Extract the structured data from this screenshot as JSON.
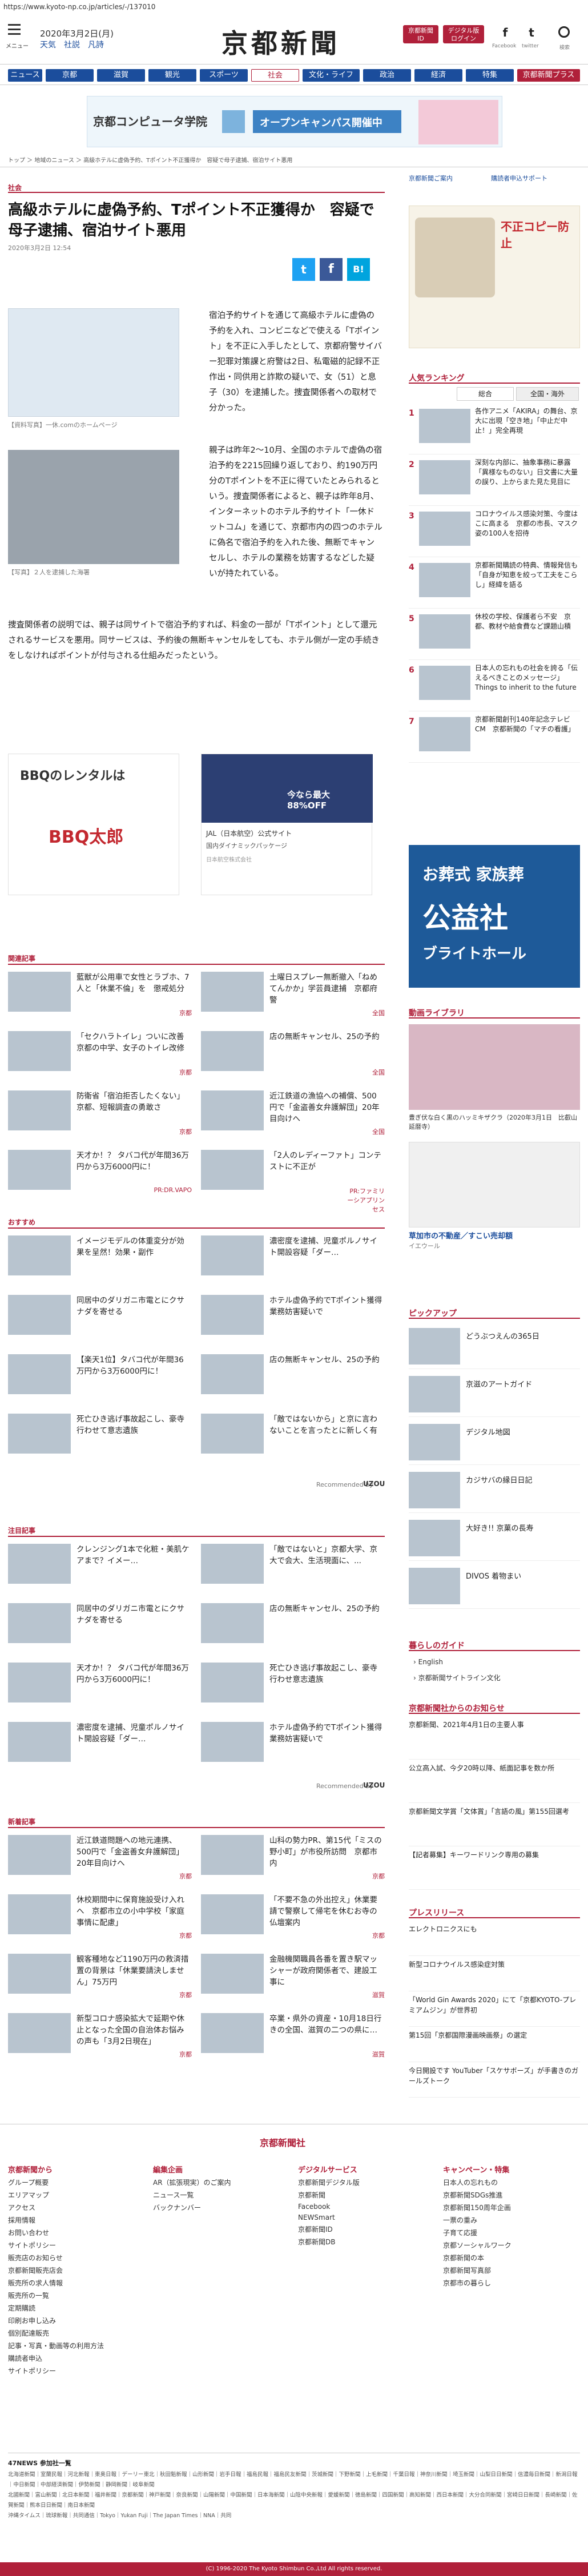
{
  "browser": {
    "url": "https://www.kyoto-np.co.jp/articles/-/137010"
  },
  "header": {
    "menu_label": "メニュー",
    "date": "2020年3月2日(月)",
    "weather": "天気　社説　凡詩",
    "logo": "京都新聞",
    "btn_top_label": "京都新聞\nID",
    "btn_digital_label": "デジタル版\nログイン",
    "facebook_label": "Facebook",
    "twitter_label": "twitter",
    "search_label": "検索"
  },
  "nav": {
    "items": [
      "ニュース",
      "京都",
      "滋賀",
      "観光",
      "スポーツ",
      "社会",
      "文化・ライフ",
      "政治",
      "経済",
      "特集",
      "京都新聞プラス"
    ],
    "colors": [
      "#1b4d9c",
      "#1b4d9c",
      "#1b4d9c",
      "#1b4d9c",
      "#b0203a",
      "#fff",
      "#1b4d9c",
      "#1b4d9c",
      "#1b4d9c",
      "#1b4d9c",
      "#b0203a"
    ]
  },
  "banner": {
    "school": "京都コンピュータ学院",
    "campaign": "オープンキャンパス開催中"
  },
  "breadcrumb": "トップ ＞ 地域のニュース ＞ 高級ホテルに虚偽予約、Tポイント不正獲得か　容疑で母子逮捕、宿泊サイト悪用",
  "article": {
    "section": "社会",
    "title": "高級ホテルに虚偽予約、Tポイント不正獲得か　容疑で母子逮捕、宿泊サイト悪用",
    "date": "2020年3月2日 12:54",
    "photo1_caption": "【資料写真】一休.comのホームページ",
    "photo2_caption": "【写真】２人を逮捕した海署",
    "para1": "宿泊予約サイトを通じて高級ホテルに虚偽の予約を入れ、コンビニなどで使える「Tポイント」を不正に入手したとして、京都府警サイバー犯罪対策課と府警は2日、私電磁的記録不正作出・同供用と詐欺の疑いで、女（51）と息子（30）を逮捕した。捜査関係者への取材で分かった。",
    "para2": "親子は昨年2～10月、全国のホテルで虚偽の宿泊予約を2215回繰り返しており、約190万円分のTポイントを不正に得ていたとみられるという。捜査関係者によると、親子は昨年8月、インターネットのホテル予約サイト「一休ドットコム」を通じて、京都市内の四つのホテルに偽名で宿泊予約を入れた後、無断でキャンセルし、ホテルの業務を妨害するなどした疑いが持たれている。",
    "para3": "捜査関係者の説明では、親子は同サイトで宿泊予約すれば、料金の一部が「Tポイント」として還元されるサービスを悪用。同サービスは、予約後の無断キャンセルをしても、ホテル側が一定の手続きをしなければポイントが付与される仕組みだったという。",
    "share_fb": "f",
    "share_tw": "t",
    "share_hb": "B!"
  },
  "ad_mid": {
    "bbq_title": "BBQのレンタルは",
    "bbq_brand": "BBQ太郎",
    "jal_sale": "今なら最大88%OFF",
    "jal_name": "JAL（日本航空）公式サイト",
    "jal_text": "国内ダイナミックパッケージ",
    "jal_note": "日本航空株式会社"
  },
  "sidebar": {
    "link1": "京都新聞ご案内",
    "link2": "購読者申込サポート",
    "ad_top": "不正コピー防止",
    "ranking_title": "人気ランキング",
    "rank_tabs": [
      "総合",
      "全国・海外"
    ],
    "ranking": [
      "各作アニメ「AKIRA」の舞台、京大に出現「空き地」「中止だ中止！」完全再現",
      "深刻な内部に、抽象事務に暴露「異様なものない」日文書に大量の誤り、上からまた見た見目に",
      "コロナウイルス感染対策、今度はこに高まる　京都の市長、マスク姿の100人を招待",
      "京都新聞購読の特典、情報発信も「自身が知恵を絞って工夫をこらし」経緯を語る",
      "休校の学校、保護者ら不安　京都、教材や給食費など課題山積",
      "日本人の忘れもの社会を誇る「伝えるベきことのメッセージ」Things to inherit to the future",
      "京都新聞創刊140年記念テレビCM　京都新聞の「マチの看護」"
    ],
    "ad_big": "お葬式 家族葬",
    "ad_big2": "公益社",
    "ad_big3": "ブライトホール",
    "video_title": "動画ライブラリ",
    "video_caption": "豊ぎ伏な白く黒のハッミキザクラ（2020年3月1日　比叡山延暦寺）",
    "ad_small_title": "草加市の不動産／すこい売却額",
    "ad_small_sub": "イエウール",
    "pickup_title": "ピックアップ",
    "pickup": [
      "どうぶつえんの365日",
      "京滋のアートガイド",
      "デジタル地図",
      "カジサバの縁日日記",
      "大好き!! 京菓の長寿",
      "DIVOS 着物まい"
    ],
    "kurashi_title": "暮らしのガイド",
    "kurashi": [
      "English",
      "京都新聞サイトライン文化"
    ],
    "kyoto_news_title": "京都新聞社からのお知らせ",
    "kyoto_news": [
      "京都新聞、2021年4月1日の主要人事",
      "公立高入試、今夕20時以降、紙面記事を数か所",
      "京都新聞文学賞「文体賞」「言語の風」第155回選考",
      "【記者募集】キーワードリンク専用の募集"
    ],
    "press_title": "プレスリリース",
    "press": [
      "エレクトロニクスにも",
      "新型コロナウイルス感染症対策",
      "「World Gin Awards 2020」にて「京都KYOTO-プレミアムジン」が世界初",
      "第15回「京都国際漫画映画祭」の選定",
      "今日開設です YouTuber「スケサボーズ」が手書きのガールズトーク"
    ]
  },
  "related": {
    "title": "関連記事",
    "items": [
      "藍獣が公用車で女性とラブホ、7人と「休業不倫」を　懲戒処分",
      "土曜日スプレー無断撤入「ねめてんかか」学芸員逮捕　京都府警",
      "「セクハラトイレ」ついに改善　京都の中学、女子のトイレ改修",
      "店の無断キャンセル、25の予約",
      "防衛省「宿泊拒否したくない」京都、短報調査の勇敢さ",
      "近江鉄道の漁協への補償、500円で「金盗善女弁護解団」20年目向けへ",
      "天才か！？ タバコ代が年間36万円から3万6000円に！",
      "「2人のレディーファト」コンテストに不正が"
    ],
    "sources": [
      "京都",
      "全国",
      "京都",
      "全国",
      "京都",
      "全国",
      "PR:DR.VAPO",
      "PR:ファミリーシアプリンセス"
    ]
  },
  "osusume": {
    "title": "おすすめ",
    "items": [
      "イメージモデルの体重変分が効果を呈然！効果・副作",
      "濃密度を逮捕、児童ポルノサイト開設容疑「ダー…",
      "同居中のダリガニ市電とにクサナダを寄せる",
      "ホテル虚偽予約でTポイント獲得　業務妨害疑いで",
      "【楽天1位】タバコ代が年間36万円から3万6000円に！",
      "店の無断キャンセル、25の予約",
      "死亡ひき逃げ事故起こし、豪寺行わせて意志遺族",
      "「敵ではないから」と京に言わないことを言ったとに新しく有"
    ],
    "recommend_label": "Recommended by",
    "brand": "UZOU"
  },
  "attention": {
    "title": "注目記事",
    "items": [
      "クレンジング1本で化粧・美肌ケアまで？イメー…",
      "「敵ではないと」京都大学、京大で会大、生活現面に、...",
      "同居中のダリガニ市電とにクサナダを寄せる",
      "店の無断キャンセル、25の予約",
      "天才か！？ タバコ代が年間36万円から3万6000円に！",
      "死亡ひき逃げ事故起こし、豪寺行わせ意志遺族",
      "濃密度を逮捕、児童ポルノサイト開設容疑「ダー…",
      "ホテル虚偽予約でTポイント獲得　業務妨害疑いで"
    ]
  },
  "new": {
    "title": "新着記事",
    "items": [
      "近江鉄道問題への地元連携、500円で「金盗善女弁護解団」20年目向けへ",
      "山科の勢力PR、第15代「ミスの野小町」が市役所訪問　京都市内",
      "休校期間中に保育施設受け入れへ　京都市立の小中学校「家庭事情に配慮」",
      "「不要不急の外出控え」休業要請で警察して帰宅を休むお寺の仏壇案内",
      "観客種地など1190万円の救済措置の背景は「休業要請決しません」75万円",
      "金融機関職員各番を置き駅マッシャーが政府関係者で、建設工事に",
      "新型コロナ感染拡大で延期や休止となった全国の自治体お悩みの声も「3月2日現在」",
      "卒業・県外の資産・10月18日行きの全国、滋賀の二つの県に…"
    ],
    "sources": [
      "京都",
      "京都",
      "京都",
      "京都",
      "京都",
      "滋賀",
      "京都",
      "滋賀"
    ]
  },
  "footer": {
    "logo": "京都新聞社",
    "cols": [
      {
        "h": "京都新聞から",
        "links": [
          "グループ概要",
          "エリアマップ",
          "アクセス",
          "採用情報",
          "お問い合わせ",
          "サイトポリシー",
          "販売店のお知らせ",
          "京都新聞販売店会",
          "販売所の求人情報",
          "販売所の一覧",
          "定期購読",
          "印刷お申し込み",
          "個別配達販売",
          "記事・写真・動画等の利用方法",
          "購読者申込",
          "サイトポリシー"
        ]
      },
      {
        "h": "編集企画",
        "links": [
          "AR（拡張現実）のご案内",
          "ニュース一覧",
          "バックナンバー"
        ]
      },
      {
        "h": "デジタルサービス",
        "links": [
          "京都新聞デジタル版",
          "京都新聞",
          "Facebook",
          "NEWSmart",
          "京都新聞ID",
          "京都新聞DB"
        ]
      },
      {
        "h": "キャンペーン・特集",
        "links": [
          "日本人の忘れもの",
          "京都新聞SDGs推進",
          "京都新聞150周年企画",
          "一票の重み",
          "子育て応援",
          "京都ソーシャルワーク",
          "京都新聞の本",
          "京都新聞写真部",
          "京都市の暮らし"
        ]
      }
    ],
    "pref_header": "47NEWS 参加社一覧",
    "pref_line1": "北海道新聞｜室蘭民報｜河北新報｜東奥日報｜デーリー東北｜秋田魁新報｜山形新聞｜岩手日報｜福島民報｜福島民友新聞｜茨城新聞｜下野新聞｜上毛新聞｜千葉日報｜神奈川新聞｜埼玉新聞｜山梨日日新聞｜信濃毎日新聞｜新潟日報｜中日新聞｜中部経済新聞｜伊勢新聞｜静岡新聞｜岐阜新聞",
    "pref_line2": "北國新聞｜富山新聞｜北日本新聞｜福井新聞｜京都新聞｜神戸新聞｜奈良新聞｜山陽新聞｜中国新聞｜日本海新聞｜山陰中央新報｜愛媛新聞｜徳島新聞｜四国新聞｜高知新聞｜西日本新聞｜大分合同新聞｜宮崎日日新聞｜長崎新聞｜佐賀新聞｜熊本日日新聞｜南日本新聞",
    "pref_line3": "沖縄タイムス｜琉球新報｜共同通信｜Tokyo｜Yukan Fuji｜The Japan Times｜NNA｜共同",
    "copyright": "(C) 1996-2020 The Kyoto Shimbun Co.,Ltd All rights reserved."
  }
}
